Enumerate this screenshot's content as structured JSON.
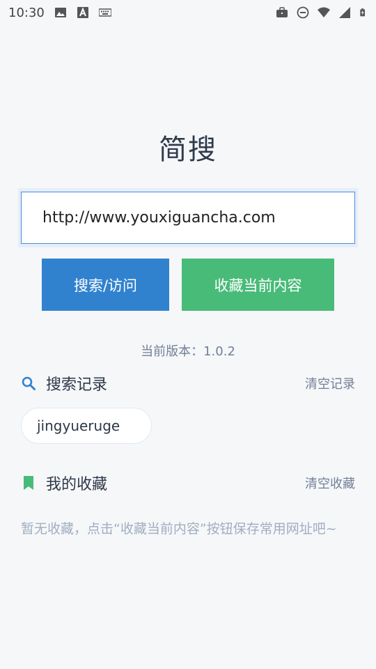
{
  "status_bar": {
    "time": "10:30",
    "icons": [
      "image-icon",
      "text-a-icon",
      "keyboard-icon",
      "briefcase-icon",
      "dnd-icon",
      "wifi-icon",
      "signal-icon",
      "battery-charging-icon"
    ]
  },
  "app": {
    "title": "简搜",
    "search_value": "http://www.youxiguancha.com",
    "search_button": "搜索/访问",
    "favorite_button": "收藏当前内容",
    "version": "当前版本：1.0.2"
  },
  "history": {
    "icon": "search-icon",
    "label": "搜索记录",
    "clear": "清空记录",
    "items": [
      "jingyueruge"
    ]
  },
  "favorites": {
    "icon": "bookmark-icon",
    "label": "我的收藏",
    "clear": "清空收藏",
    "empty": "暂无收藏，点击“收藏当前内容”按钮保存常用网址吧~"
  },
  "colors": {
    "primary": "#3182ce",
    "success": "#48bb78",
    "background": "#f6f7f9"
  }
}
